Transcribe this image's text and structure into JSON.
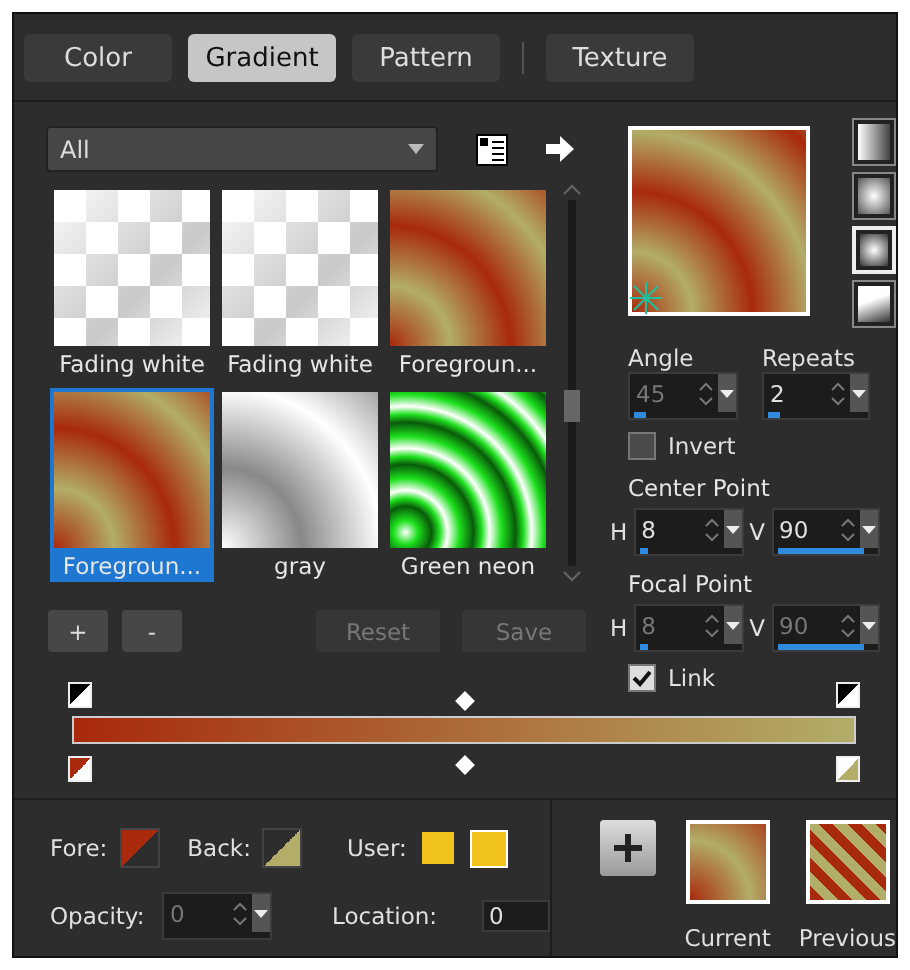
{
  "tabs": [
    {
      "label": "Color",
      "selected": false
    },
    {
      "label": "Gradient",
      "selected": true
    },
    {
      "label": "Pattern",
      "selected": false
    },
    {
      "label": "Texture",
      "selected": false
    }
  ],
  "category": {
    "value": "All"
  },
  "gradients": [
    {
      "name": "Fading white",
      "kind": "checker",
      "selected": false
    },
    {
      "name": "Fading white",
      "kind": "checker",
      "selected": false
    },
    {
      "name": "Foregroun...",
      "kind": "rust",
      "selected": false
    },
    {
      "name": "Foregroun...",
      "kind": "rust",
      "selected": true
    },
    {
      "name": "gray",
      "kind": "gray",
      "selected": false
    },
    {
      "name": "Green neon",
      "kind": "neon",
      "selected": false
    }
  ],
  "list_buttons": [
    {
      "label": "+",
      "disabled": false
    },
    {
      "label": "-",
      "disabled": false
    },
    {
      "label": "Reset",
      "disabled": true
    },
    {
      "label": "Save",
      "disabled": true
    }
  ],
  "styles": [
    {
      "kind": "linear",
      "selected": false
    },
    {
      "kind": "rectangular",
      "selected": false
    },
    {
      "kind": "radial",
      "selected": true
    },
    {
      "kind": "corner",
      "selected": false
    }
  ],
  "angle": {
    "label": "Angle",
    "value": "45",
    "disabled": true,
    "level": 0.12
  },
  "repeats": {
    "label": "Repeats",
    "value": "2",
    "disabled": false,
    "level": 0.12
  },
  "invert": {
    "label": "Invert",
    "checked": false
  },
  "center_point": {
    "label": "Center Point",
    "h": {
      "label": "H",
      "value": "8",
      "disabled": false,
      "level": 0.08
    },
    "v": {
      "label": "V",
      "value": "90",
      "disabled": false,
      "level": 0.9
    }
  },
  "focal_point": {
    "label": "Focal Point",
    "h": {
      "label": "H",
      "value": "8",
      "disabled": true,
      "level": 0.08
    },
    "v": {
      "label": "V",
      "value": "90",
      "disabled": true,
      "level": 0.9
    }
  },
  "link": {
    "label": "Link",
    "checked": true
  },
  "color_sources": [
    {
      "label": "Fore:",
      "color": "#a8290b"
    },
    {
      "label": "Back:",
      "color": "#b2ad68"
    },
    {
      "label": "User:",
      "color": "#f2c21c"
    }
  ],
  "opacity": {
    "label": "Opacity:",
    "value": "0",
    "disabled": true
  },
  "location": {
    "label": "Location:",
    "value": "0"
  },
  "presets": [
    {
      "label": "Current",
      "kind": "radial"
    },
    {
      "label": "Previous",
      "kind": "stripes"
    }
  ]
}
